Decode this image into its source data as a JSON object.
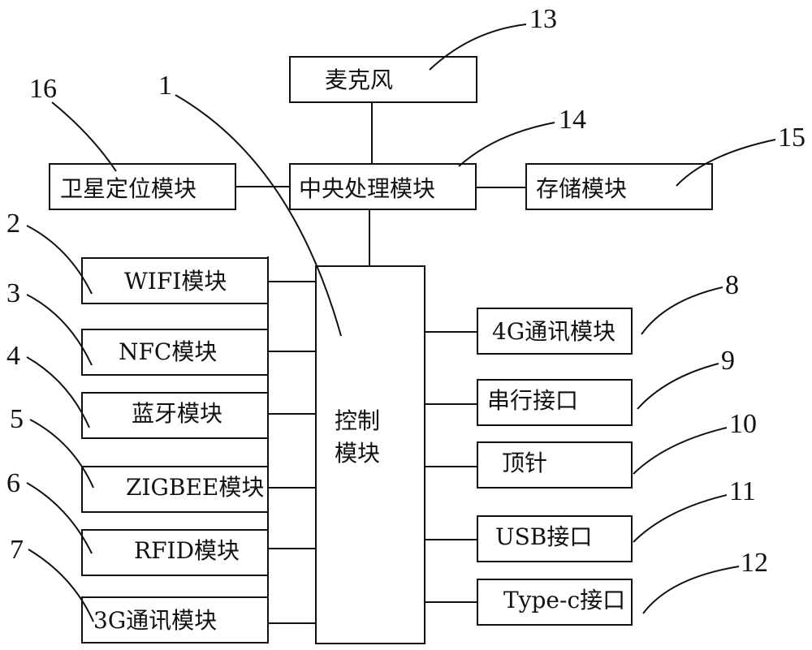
{
  "diagram": {
    "type": "block-diagram",
    "modules": {
      "microphone": {
        "label": "麦克风",
        "ref": "13"
      },
      "cpu": {
        "label": "中央处理模块",
        "ref": "14"
      },
      "storage": {
        "label": "存储模块",
        "ref": "15"
      },
      "satellite": {
        "label": "卫星定位模块",
        "ref": "16"
      },
      "control": {
        "label_line1": "控制",
        "label_line2": "模块",
        "ref": "1"
      },
      "wifi": {
        "label": "WIFI模块",
        "ref": "2"
      },
      "nfc": {
        "label": "NFC模块",
        "ref": "3"
      },
      "bluetooth": {
        "label": "蓝牙模块",
        "ref": "4"
      },
      "zigbee": {
        "label": "ZIGBEE模块",
        "ref": "5"
      },
      "rfid": {
        "label": "RFID模块",
        "ref": "6"
      },
      "comm3g": {
        "label": "3G通讯模块",
        "ref": "7"
      },
      "comm4g": {
        "label": "4G通讯模块",
        "ref": "8"
      },
      "serial": {
        "label": "串行接口",
        "ref": "9"
      },
      "pin": {
        "label": "顶针",
        "ref": "10"
      },
      "usb": {
        "label": "USB接口",
        "ref": "11"
      },
      "typec": {
        "label": "Type-c接口",
        "ref": "12"
      }
    },
    "connections": [
      [
        "microphone",
        "cpu"
      ],
      [
        "satellite",
        "cpu"
      ],
      [
        "cpu",
        "storage"
      ],
      [
        "cpu",
        "control"
      ],
      [
        "wifi",
        "control"
      ],
      [
        "nfc",
        "control"
      ],
      [
        "bluetooth",
        "control"
      ],
      [
        "zigbee",
        "control"
      ],
      [
        "rfid",
        "control"
      ],
      [
        "comm3g",
        "control"
      ],
      [
        "control",
        "comm4g"
      ],
      [
        "control",
        "serial"
      ],
      [
        "control",
        "pin"
      ],
      [
        "control",
        "usb"
      ],
      [
        "control",
        "typec"
      ]
    ]
  }
}
